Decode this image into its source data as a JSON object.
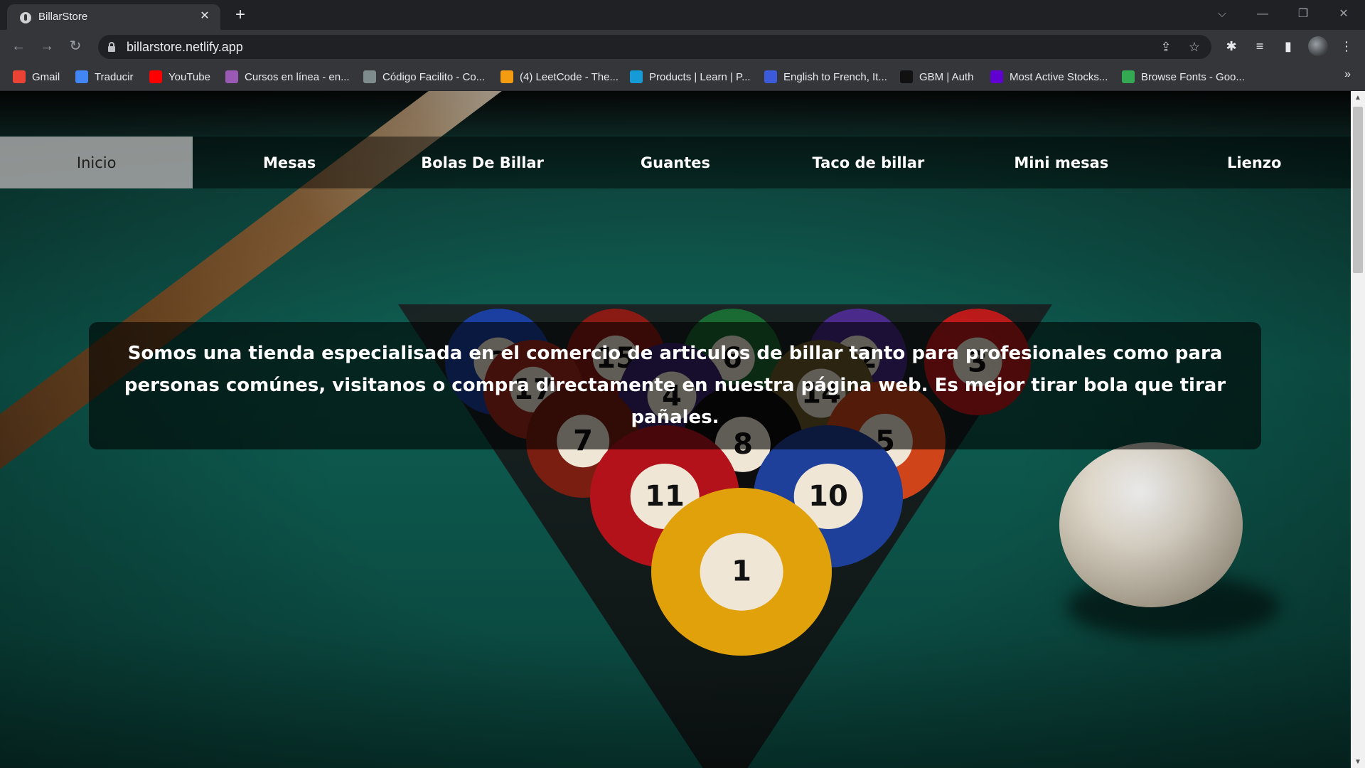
{
  "browser": {
    "tab_title": "BillarStore",
    "tab_close": "✕",
    "new_tab": "+",
    "url": "billarstore.netlify.app",
    "window_controls": {
      "tab_search": "⌵",
      "minimize": "—",
      "restore": "❐",
      "close": "✕"
    },
    "nav": {
      "back": "←",
      "forward": "→",
      "reload": "↻"
    },
    "icons": {
      "share": "⇪",
      "star": "☆",
      "extensions": "✱",
      "media": "≡",
      "sidepanel": "▮",
      "menu": "⋮"
    },
    "bookmarks_more": "»",
    "bookmarks": [
      {
        "label": "Gmail",
        "color": "#ea4335"
      },
      {
        "label": "Traducir",
        "color": "#4285f4"
      },
      {
        "label": "YouTube",
        "color": "#ff0000"
      },
      {
        "label": "Cursos en línea - en...",
        "color": "#9b59b6"
      },
      {
        "label": "Código Facilito - Co...",
        "color": "#7f8c8d"
      },
      {
        "label": "(4) LeetCode - The...",
        "color": "#f39c12"
      },
      {
        "label": "Products | Learn | P...",
        "color": "#179bd7"
      },
      {
        "label": "English to French, It...",
        "color": "#3b5bdb"
      },
      {
        "label": "GBM | Auth",
        "color": "#111111"
      },
      {
        "label": "Most Active Stocks...",
        "color": "#6001d2"
      },
      {
        "label": "Browse Fonts - Goo...",
        "color": "#34a853"
      }
    ]
  },
  "site": {
    "nav": [
      {
        "label": "Inicio",
        "active": true
      },
      {
        "label": "Mesas"
      },
      {
        "label": "Bolas De Billar"
      },
      {
        "label": "Guantes"
      },
      {
        "label": "Taco de billar"
      },
      {
        "label": "Mini mesas"
      },
      {
        "label": "Lienzo"
      }
    ],
    "hero_text": "Somos una tienda especialisada en el comercio de articulos de billar tanto para profesionales como para personas comúnes, visitanos o compra directamente en nuestra página web. Es mejor tirar bola que tirar pañales.",
    "background_balls": [
      "15",
      "6",
      "12",
      "2",
      "3",
      "17",
      "4",
      "14",
      "7",
      "8",
      "5",
      "11",
      "10",
      "1"
    ]
  },
  "scrollbar": {
    "up": "▲",
    "down": "▼"
  }
}
